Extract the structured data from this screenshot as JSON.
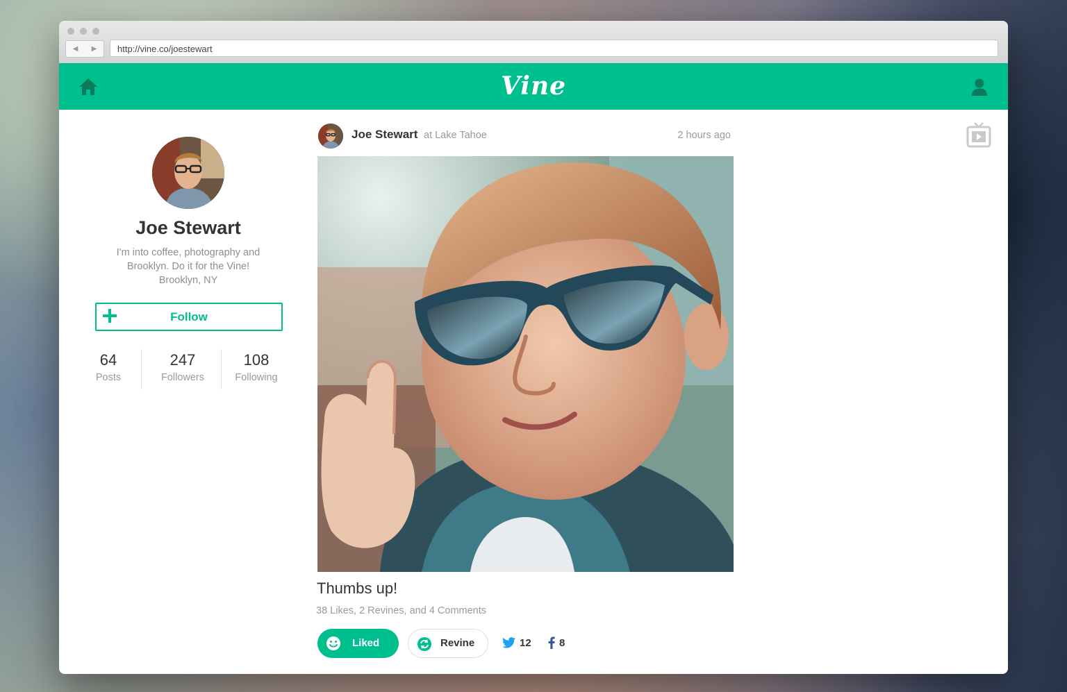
{
  "browser": {
    "url": "http://vine.co/joestewart",
    "back_glyph": "◀",
    "forward_glyph": "▶"
  },
  "header": {
    "logo_text": "Vine",
    "left_icon": "home-icon",
    "right_icon": "user-icon",
    "brand_color": "#00bf8f"
  },
  "profile": {
    "name": "Joe Stewart",
    "bio": "I'm into coffee, photography and Brooklyn. Do it for the Vine!",
    "location": "Brooklyn, NY",
    "follow_label": "Follow",
    "stats": [
      {
        "value": "64",
        "label": "Posts"
      },
      {
        "value": "247",
        "label": "Followers"
      },
      {
        "value": "108",
        "label": "Following"
      }
    ]
  },
  "post": {
    "author": "Joe Stewart",
    "location": "at Lake Tahoe",
    "time": "2 hours ago",
    "caption": "Thumbs up!",
    "stats": "38 Likes, 2 Revines, and 4 Comments",
    "liked_label": "Liked",
    "revine_label": "Revine",
    "twitter_count": "12",
    "facebook_count": "8"
  }
}
